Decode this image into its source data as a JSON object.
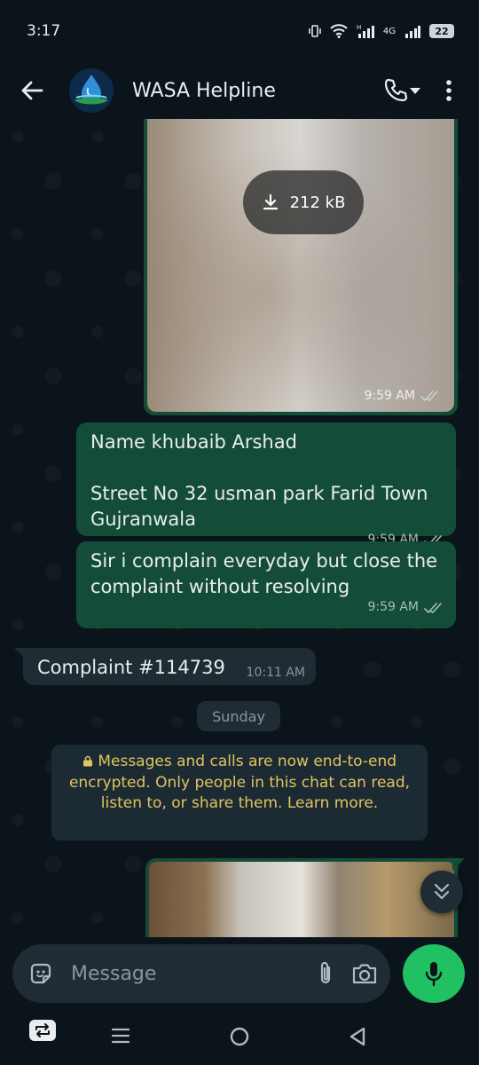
{
  "status_bar": {
    "time": "3:17",
    "network": "4G",
    "battery": "22"
  },
  "header": {
    "contact_name": "WASA Helpline"
  },
  "messages": [
    {
      "type": "image",
      "direction": "out",
      "download_size": "212 kB",
      "time": "9:59 AM"
    },
    {
      "type": "text",
      "direction": "out",
      "text": "Name khubaib Arshad\n\nStreet No 32 usman park Farid Town Gujranwala",
      "time": "9:59 AM"
    },
    {
      "type": "text",
      "direction": "out",
      "text": "Sir i complain everyday but close the complaint without resolving",
      "time": "9:59 AM"
    },
    {
      "type": "text",
      "direction": "in",
      "text": "Complaint #114739",
      "time": "10:11 AM"
    }
  ],
  "date_separator": "Sunday",
  "encryption_notice": "Messages and calls are now end-to-end encrypted. Only people in this chat can read, listen to, or share them. Learn more.",
  "composer": {
    "placeholder": "Message"
  },
  "colors": {
    "accent_green": "#21c063",
    "outgoing_bubble": "#144d37",
    "incoming_bubble": "#1f2c34",
    "notice_text": "#e2c45f",
    "background": "#0b141a"
  }
}
